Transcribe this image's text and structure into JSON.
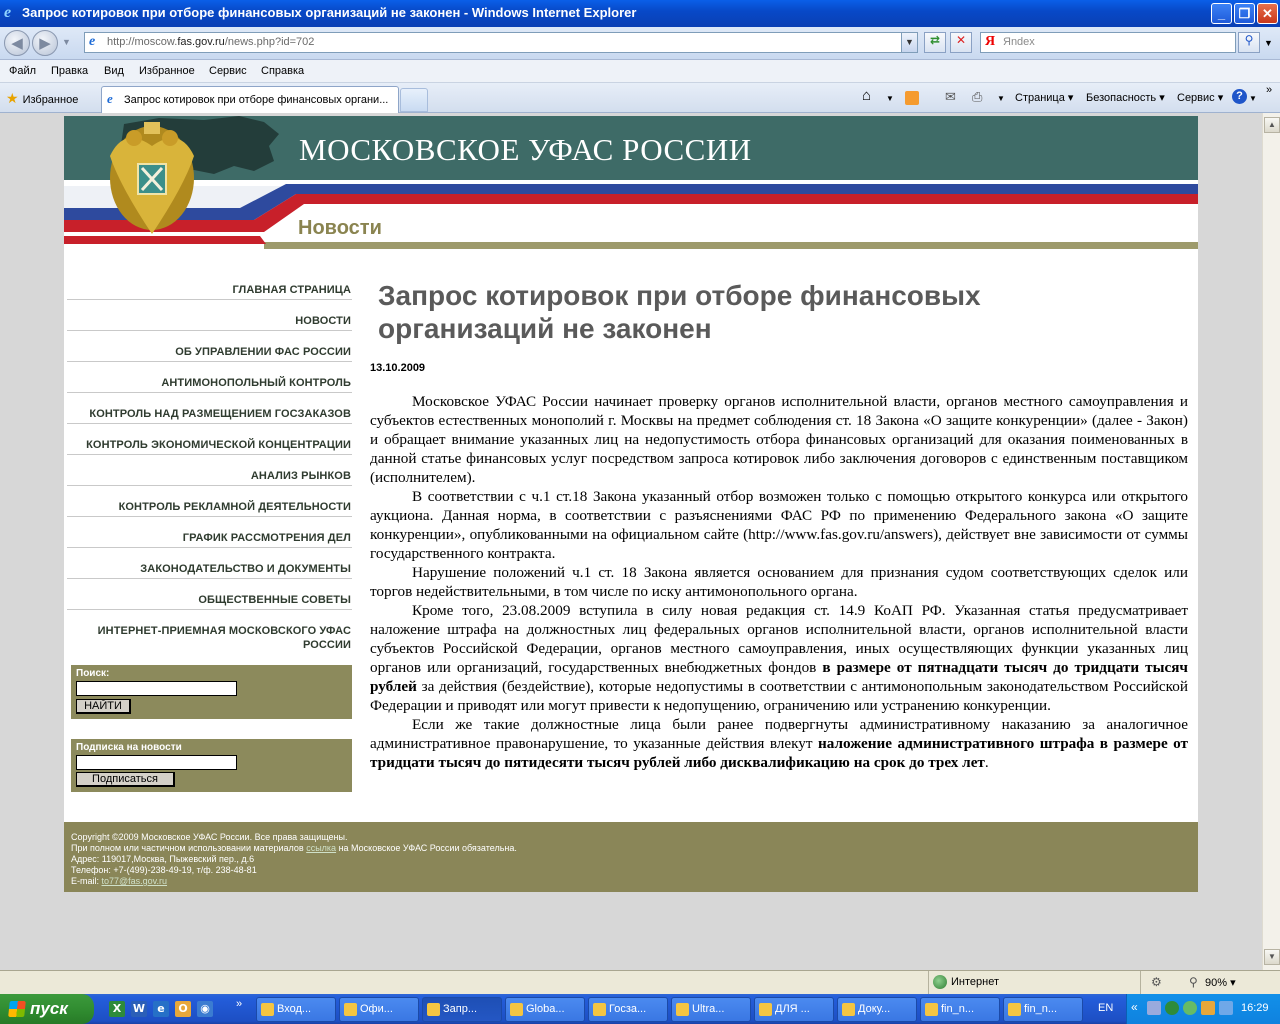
{
  "window": {
    "title": "Запрос котировок при отборе финансовых организаций не законен - Windows Internet Explorer",
    "buttons": [
      "_",
      "❐",
      "✕"
    ]
  },
  "address_bar": {
    "url_prefix": "http://moscow.",
    "url_domain": "fas.gov.ru",
    "url_path": "/news.php?id=702",
    "search_placeholder": "Яndex"
  },
  "menu": [
    "Файл",
    "Правка",
    "Вид",
    "Избранное",
    "Сервис",
    "Справка"
  ],
  "tabs": {
    "favorites_label": "Избранное",
    "active_tab": "Запрос котировок при отборе финансовых органи...",
    "commands": [
      "Страница",
      "Безопасность",
      "Сервис"
    ]
  },
  "site": {
    "title": "МОСКОВСКОЕ УФАС РОССИИ",
    "section": "Новости",
    "colors": {
      "teal": "#3e6b67",
      "olive": "#8a8658",
      "red": "#c8202a",
      "blue": "#2e4a9e"
    }
  },
  "nav": [
    "ГЛАВНАЯ СТРАНИЦА",
    "НОВОСТИ",
    "ОБ УПРАВЛЕНИИ ФАС РОССИИ",
    "АНТИМОНОПОЛЬНЫЙ КОНТРОЛЬ",
    "КОНТРОЛЬ НАД РАЗМЕЩЕНИЕМ ГОСЗАКАЗОВ",
    "КОНТРОЛЬ ЭКОНОМИЧЕСКОЙ КОНЦЕНТРАЦИИ",
    "АНАЛИЗ РЫНКОВ",
    "КОНТРОЛЬ РЕКЛАМНОЙ ДЕЯТЕЛЬНОСТИ",
    "ГРАФИК РАССМОТРЕНИЯ ДЕЛ",
    "ЗАКОНОДАТЕЛЬСТВО И ДОКУМЕНТЫ",
    "ОБЩЕСТВЕННЫЕ СОВЕТЫ",
    "ИНТЕРНЕТ-ПРИЕМНАЯ МОСКОВСКОГО УФАС РОССИИ"
  ],
  "search": {
    "label": "Поиск:",
    "button": "НАЙТИ"
  },
  "subscribe": {
    "label": "Подписка на новости",
    "button": "Подписаться"
  },
  "article": {
    "title": "Запрос котировок при отборе финансовых организаций не законен",
    "date": "13.10.2009",
    "p1": "Московское УФАС России начинает проверку органов исполнительной власти, органов местного самоуправления и субъектов естественных монополий г. Москвы на предмет соблюдения ст. 18 Закона «О защите конкуренции» (далее - Закон) и обращает внимание указанных лиц на недопустимость отбора финансовых организаций для оказания поименованных в данной статье финансовых услуг посредством запроса котировок либо заключения договоров с единственным поставщиком (исполнителем).",
    "p2": "В соответствии с ч.1 ст.18 Закона указанный отбор возможен только с помощью открытого конкурса или открытого аукциона. Данная норма, в соответствии с разъяснениями ФАС РФ по применению Федерального закона «О защите конкуренции», опубликованными на официальном сайте (http://www.fas.gov.ru/answers), действует вне зависимости от суммы государственного контракта.",
    "p3": "Нарушение положений ч.1 ст. 18 Закона является основанием для признания судом соответствующих сделок или торгов недействительными, в том числе по иску антимонопольного органа.",
    "p4_a": "Кроме того, 23.08.2009 вступила в силу новая редакция ст. 14.9 КоАП РФ. Указанная статья предусматривает наложение штрафа на должностных лиц федеральных органов исполнительной власти, органов исполнительной власти субъектов Российской Федерации, органов местного самоуправления, иных осуществляющих функции указанных лиц органов или организаций, государственных внебюджетных фондов ",
    "p4_b": "в размере от пятнадцати тысяч до тридцати тысяч рублей",
    "p4_c": " за действия (бездействие), которые недопустимы в соответствии с антимонопольным законодательством Российской Федерации и приводят или могут привести к недопущению, ограничению или устранению конкуренции.",
    "p5_a": "Если же такие должностные лица были ранее подвергнуты административному наказанию за аналогичное административное правонарушение, то указанные действия влекут ",
    "p5_b": "наложение административного штрафа в размере от тридцати тысяч до пятидесяти тысяч рублей либо дисквалификацию на срок до трех лет",
    "p5_c": "."
  },
  "footer": {
    "copyright": "Copyright ©2009 Московское УФАС России. Все права защищены.",
    "note_a": "При полном или частичном использовании материалов ",
    "note_link": "ссылка",
    "note_b": " на Московское УФАС России обязательна.",
    "address": "Адрес: 119017,Москва, Пыжевский пер., д.6",
    "phone": "Телефон: +7-(499)-238-49-19, т/ф. 238-48-81",
    "email_label": "E-mail: ",
    "email": "to77@fas.gov.ru"
  },
  "status": {
    "zone": "Интернет",
    "zoom": "90%"
  },
  "taskbar": {
    "start": "пуск",
    "tasks": [
      "Вход...",
      "Офи...",
      "Запр...",
      "Globa...",
      "Госза...",
      "Ultra...",
      "ДЛЯ ...",
      "Доку...",
      "fin_n...",
      "fin_n..."
    ],
    "lang": "EN",
    "clock": "16:29"
  }
}
